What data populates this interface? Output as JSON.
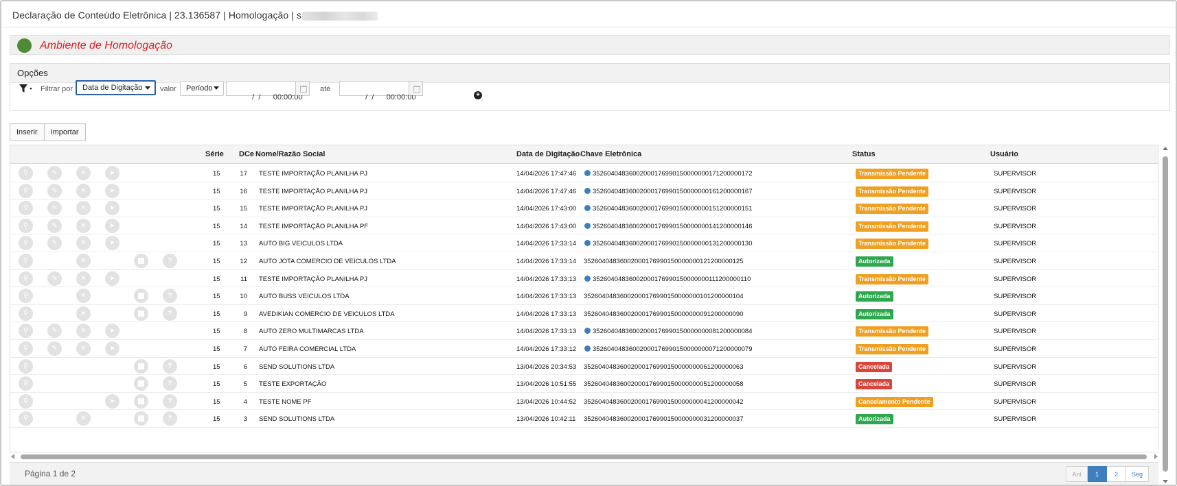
{
  "header": {
    "title": "Declaração de Conteúdo Eletrônica | 23.136587 | Homologação | s"
  },
  "environment": {
    "label": "Ambiente de Homologação",
    "color": "#4f8a35",
    "text_color": "#e02020"
  },
  "options": {
    "title": "Opções",
    "filter_label": "Filtrar por",
    "filter_value": "Data de Digitação",
    "valor_label": "valor",
    "valor_value": "Período",
    "date_from": " /  /      00:00:00",
    "ate_label": "até",
    "date_to": " /  /      00:00:00"
  },
  "toolbar": {
    "insert_label": "Inserir",
    "import_label": "Importar"
  },
  "table": {
    "columns": {
      "serie": "Série",
      "dce": "DCe",
      "nome": "Nome/Razão Social",
      "data": "Data de Digitação",
      "chave": "Chave Eletrônica",
      "status": "Status",
      "usuario": "Usuário"
    },
    "rows": [
      {
        "serie": "15",
        "dce": "17",
        "nome": "TESTE IMPORTAÇÃO PLANILHA PJ",
        "data": "14/04/2026 17:47:46",
        "chave": "35260404836002000176990150000000171200000172",
        "status": "Transmissão Pendente",
        "usuario": "SUPERVISOR"
      },
      {
        "serie": "15",
        "dce": "16",
        "nome": "TESTE IMPORTAÇÃO PLANILHA PJ",
        "data": "14/04/2026 17:47:46",
        "chave": "35260404836002000176990150000000161200000167",
        "status": "Transmissão Pendente",
        "usuario": "SUPERVISOR"
      },
      {
        "serie": "15",
        "dce": "15",
        "nome": "TESTE IMPORTAÇÃO PLANILHA PJ",
        "data": "14/04/2026 17:43:00",
        "chave": "35260404836002000176990150000000151200000151",
        "status": "Transmissão Pendente",
        "usuario": "SUPERVISOR"
      },
      {
        "serie": "15",
        "dce": "14",
        "nome": "TESTE IMPORTAÇÃO PLANILHA PF",
        "data": "14/04/2026 17:43:00",
        "chave": "35260404836002000176990150000000141200000146",
        "status": "Transmissão Pendente",
        "usuario": "SUPERVISOR"
      },
      {
        "serie": "15",
        "dce": "13",
        "nome": "AUTO BIG VEICULOS LTDA",
        "data": "14/04/2026 17:33:14",
        "chave": "35260404836002000176990150000000131200000130",
        "status": "Transmissão Pendente",
        "usuario": "SUPERVISOR"
      },
      {
        "serie": "15",
        "dce": "12",
        "nome": "AUTO JOTA COMERCIO DE VEICULOS LTDA",
        "data": "14/04/2026 17:33:14",
        "chave": "35260404836002000176990150000000121200000125",
        "status": "Autorizada",
        "usuario": "SUPERVISOR"
      },
      {
        "serie": "15",
        "dce": "11",
        "nome": "TESTE IMPORTAÇÃO PLANILHA PJ",
        "data": "14/04/2026 17:33:13",
        "chave": "35260404836002000176990150000000111200000110",
        "status": "Transmissão Pendente",
        "usuario": "SUPERVISOR"
      },
      {
        "serie": "15",
        "dce": "10",
        "nome": "AUTO BUSS VEICULOS LTDA",
        "data": "14/04/2026 17:33:13",
        "chave": "35260404836002000176990150000000101200000104",
        "status": "Autorizada",
        "usuario": "SUPERVISOR"
      },
      {
        "serie": "15",
        "dce": "9",
        "nome": "AVEDIKIAN COMERCIO DE VEICULOS LTDA",
        "data": "14/04/2026 17:33:13",
        "chave": "35260404836002000176990150000000091200000090",
        "status": "Autorizada",
        "usuario": "SUPERVISOR"
      },
      {
        "serie": "15",
        "dce": "8",
        "nome": "AUTO ZERO MULTIMARCAS LTDA",
        "data": "14/04/2026 17:33:13",
        "chave": "35260404836002000176990150000000081200000084",
        "status": "Transmissão Pendente",
        "usuario": "SUPERVISOR"
      },
      {
        "serie": "15",
        "dce": "7",
        "nome": "AUTO FEIRA COMERCIAL LTDA",
        "data": "14/04/2026 17:33:12",
        "chave": "35260404836002000176990150000000071200000079",
        "status": "Transmissão Pendente",
        "usuario": "SUPERVISOR"
      },
      {
        "serie": "15",
        "dce": "6",
        "nome": "SEND SOLUTIONS LTDA",
        "data": "13/04/2026 20:34:53",
        "chave": "35260404836002000176990150000000061200000063",
        "status": "Cancelada",
        "usuario": "SUPERVISOR"
      },
      {
        "serie": "15",
        "dce": "5",
        "nome": "TESTE EXPORTAÇÃO",
        "data": "13/04/2026 10:51:55",
        "chave": "35260404836002000176990150000000051200000058",
        "status": "Cancelada",
        "usuario": "SUPERVISOR"
      },
      {
        "serie": "15",
        "dce": "4",
        "nome": "TESTE NOME PF",
        "data": "13/04/2026 10:44:52",
        "chave": "35260404836002000176990150000000041200000042",
        "status": "Cancelamento Pendente",
        "usuario": "SUPERVISOR"
      },
      {
        "serie": "15",
        "dce": "3",
        "nome": "SEND SOLUTIONS LTDA",
        "data": "13/04/2026 10:42:11",
        "chave": "35260404836002000176990150000000031200000037",
        "status": "Autorizada",
        "usuario": "SUPERVISOR"
      }
    ]
  },
  "status_colors": {
    "Transmissão Pendente": "#f0a020",
    "Cancelamento Pendente": "#f0a020",
    "Autorizada": "#2ea84f",
    "Cancelada": "#d9453a"
  },
  "pagination": {
    "info": "Página 1 de 2",
    "prev": "Ant",
    "pages": [
      "1",
      "2"
    ],
    "current": "1",
    "next": "Seg"
  }
}
